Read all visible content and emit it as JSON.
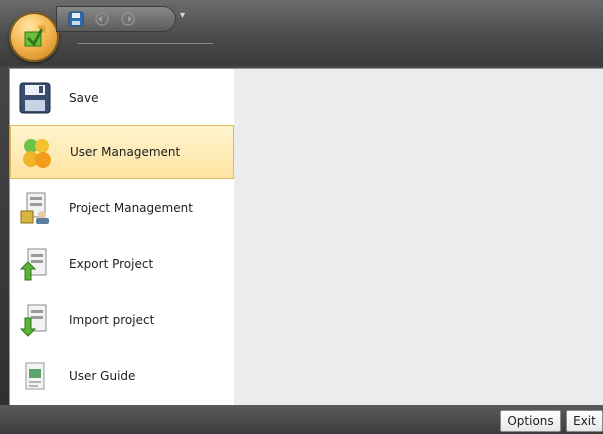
{
  "quick_access": {
    "items": [
      "save-icon",
      "undo-icon",
      "redo-icon"
    ],
    "dropdown": "▾"
  },
  "menu": {
    "items": [
      {
        "label": "Save",
        "icon": "save-icon"
      },
      {
        "label": "User Management",
        "icon": "users-icon",
        "selected": true
      },
      {
        "label": "Project Management",
        "icon": "project-management-icon"
      },
      {
        "label": "Export Project",
        "icon": "export-icon"
      },
      {
        "label": "Import project",
        "icon": "import-icon"
      },
      {
        "label": "User Guide",
        "icon": "user-guide-icon"
      }
    ]
  },
  "footer": {
    "options_label": "Options",
    "exit_label": "Exit"
  },
  "colors": {
    "accent": "#fde3a1",
    "selected_border": "#e3b85a",
    "chrome_dark": "#3b3b3b"
  }
}
